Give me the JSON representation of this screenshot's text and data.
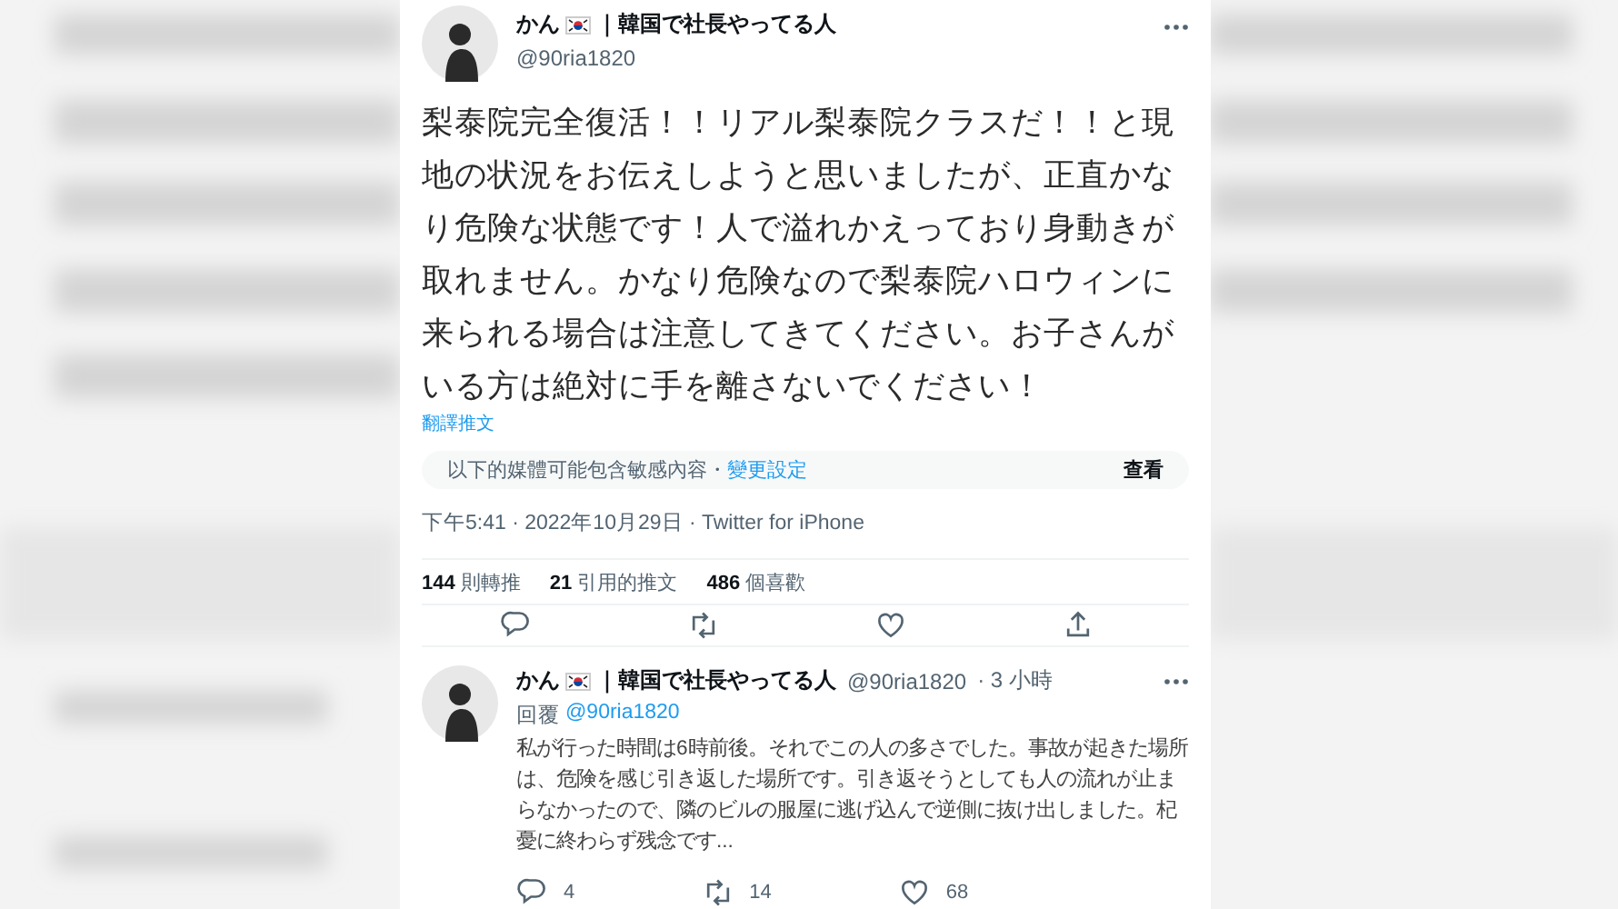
{
  "tweet": {
    "author": {
      "name": "かん",
      "tagline": "｜韓国で社長やってる人",
      "handle": "@90ria1820"
    },
    "text": "梨泰院完全復活！！リアル梨泰院クラスだ！！と現地の状況をお伝えしようと思いましたが、正直かなり危険な状態です！人で溢れかえっており身動きが取れません。かなり危険なので梨泰院ハロウィンに来られる場合は注意してきてください。お子さんがいる方は絶対に手を離さないでください！",
    "translate": "翻譯推文",
    "sensitive": {
      "notice": "以下的媒體可能包含敏感內容・",
      "link": "變更設定",
      "button": "查看"
    },
    "meta": "下午5:41 · 2022年10月29日 · Twitter for iPhone",
    "stats": [
      {
        "count": "144",
        "label": "則轉推"
      },
      {
        "count": "21",
        "label": "引用的推文"
      },
      {
        "count": "486",
        "label": "個喜歡"
      }
    ],
    "actions": [
      {
        "kind": "reply"
      },
      {
        "kind": "retweet"
      },
      {
        "kind": "like"
      },
      {
        "kind": "share"
      }
    ]
  },
  "reply": {
    "author": {
      "name": "かん",
      "tagline": "｜韓国で社長やってる人",
      "handle": "@90ria1820",
      "time": "· 3 小時"
    },
    "replying_label": "回覆",
    "replying_to": "@90ria1820",
    "text": "私が行った時間は6時前後。それでこの人の多さでした。事故が起きた場所は、危険を感じ引き返した場所です。引き返そうとしても人の流れが止まらなかったので、隣のビルの服屋に逃げ込んで逆側に抜け出しました。杞憂に終わらず残念です...",
    "actions": [
      {
        "kind": "reply",
        "count": "4"
      },
      {
        "kind": "retweet",
        "count": "14"
      },
      {
        "kind": "like",
        "count": "68"
      }
    ]
  }
}
